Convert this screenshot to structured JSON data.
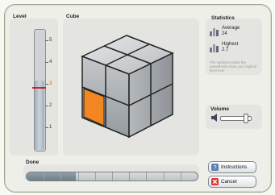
{
  "sections": {
    "level_title": "Level",
    "cube_title": "Cube",
    "statistics_title": "Statistics",
    "volume_title": "Volume",
    "done_title": "Done"
  },
  "level": {
    "ticks": [
      "5",
      "4",
      "3",
      "2",
      "1"
    ],
    "current": "3"
  },
  "statistics": {
    "average_label": "Average",
    "average_value": "24",
    "highest_label": "Highest",
    "highest_value": "2.7",
    "note": "The numbers inside the parenthesis show your highest level ever"
  },
  "volume": {
    "level_fraction": 0.85
  },
  "done": {
    "progress_fraction": 0.29
  },
  "buttons": {
    "instructions": "Instructions",
    "cancel": "Cancel"
  },
  "colors": {
    "accent": "#f08020",
    "frame_border": "#9aa98a",
    "cube_face": "#a7acb0",
    "cube_highlight": "#f28722"
  },
  "icons": {
    "average": "bar-chart-icon",
    "highest": "bar-chart-icon",
    "volume": "speaker-icon",
    "instructions": "help-icon",
    "cancel": "cancel-x-icon"
  }
}
